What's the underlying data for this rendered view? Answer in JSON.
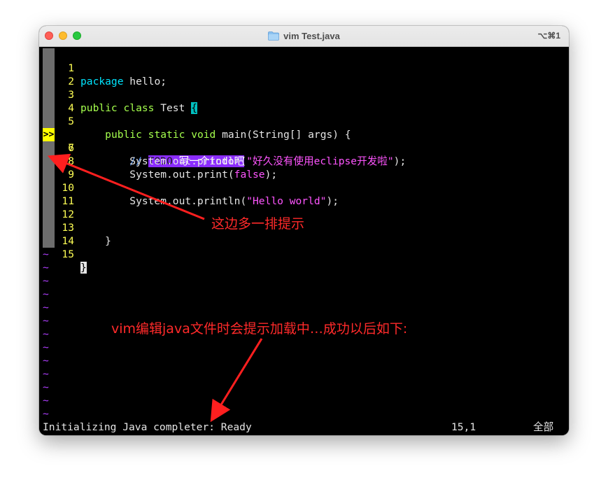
{
  "window": {
    "title": "vim Test.java",
    "shortcut": "⌥⌘1"
  },
  "editor": {
    "sign_marker": ">>",
    "lines": [
      {
        "num": "1"
      },
      {
        "num": "2"
      },
      {
        "num": "3"
      },
      {
        "num": "4"
      },
      {
        "num": "5"
      },
      {
        "num": "6"
      },
      {
        "num": "7"
      },
      {
        "num": "8"
      },
      {
        "num": "9"
      },
      {
        "num": "10"
      },
      {
        "num": "11"
      },
      {
        "num": "12"
      },
      {
        "num": "13"
      },
      {
        "num": "14"
      },
      {
        "num": "15"
      }
    ],
    "code": {
      "l1_kw": "package",
      "l1_rest": " hello;",
      "l3_kw1": "public",
      "l3_kw2": "class",
      "l3_rest": " Test ",
      "l3_brace": "{",
      "l5_indent": "    ",
      "l5_kw1": "public",
      "l5_kw2": "static",
      "l5_kw3": "void",
      "l5_rest": " main(String[] args) {",
      "l6_indent": "        ",
      "l6_comment": "// ",
      "l6_todo": "TODO",
      "l6_todo_text": " 写一个todo吧",
      "l7_pre": "        System.out.println(",
      "l7_str": "\"好久没有使用eclipse开发啦\"",
      "l7_post": ");",
      "l8_pre": "        System.out.print(",
      "l8_bool": "false",
      "l8_post": ");",
      "l10_pre": "        System.out.println(",
      "l10_str": "\"Hello world\"",
      "l10_post": ");",
      "l13_text": "    }",
      "l15_cursor": "}"
    },
    "tilde": "~",
    "tilde_count": 13
  },
  "statusline": {
    "message": "Initializing Java completer: Ready",
    "position": "15,1",
    "scroll": "全部"
  },
  "annotations": {
    "sign_note": "这边多一排提示",
    "status_note": "vim编辑java文件时会提示加载中…成功以后如下:",
    "color": "#ff2a2a"
  },
  "colors": {
    "terminal_bg": "#000000",
    "line_number": "#ffff55",
    "keyword": "#00e5ff",
    "type_keyword": "#a5ff4d",
    "string": "#ff55ff",
    "todo_bg": "#8b2cff",
    "tilde": "#b03fff",
    "sign_bg": "#ffff00"
  }
}
